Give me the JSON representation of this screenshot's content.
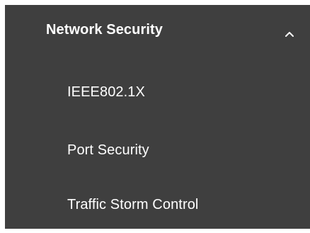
{
  "menu": {
    "section_label": "Network Security",
    "expanded_icon": "chevron-up-icon",
    "items": [
      {
        "label": "IEEE802.1X"
      },
      {
        "label": "Port Security"
      },
      {
        "label": "Traffic Storm Control"
      }
    ]
  },
  "colors": {
    "panel_background": "#3f3f3f",
    "text": "#ffffff"
  }
}
